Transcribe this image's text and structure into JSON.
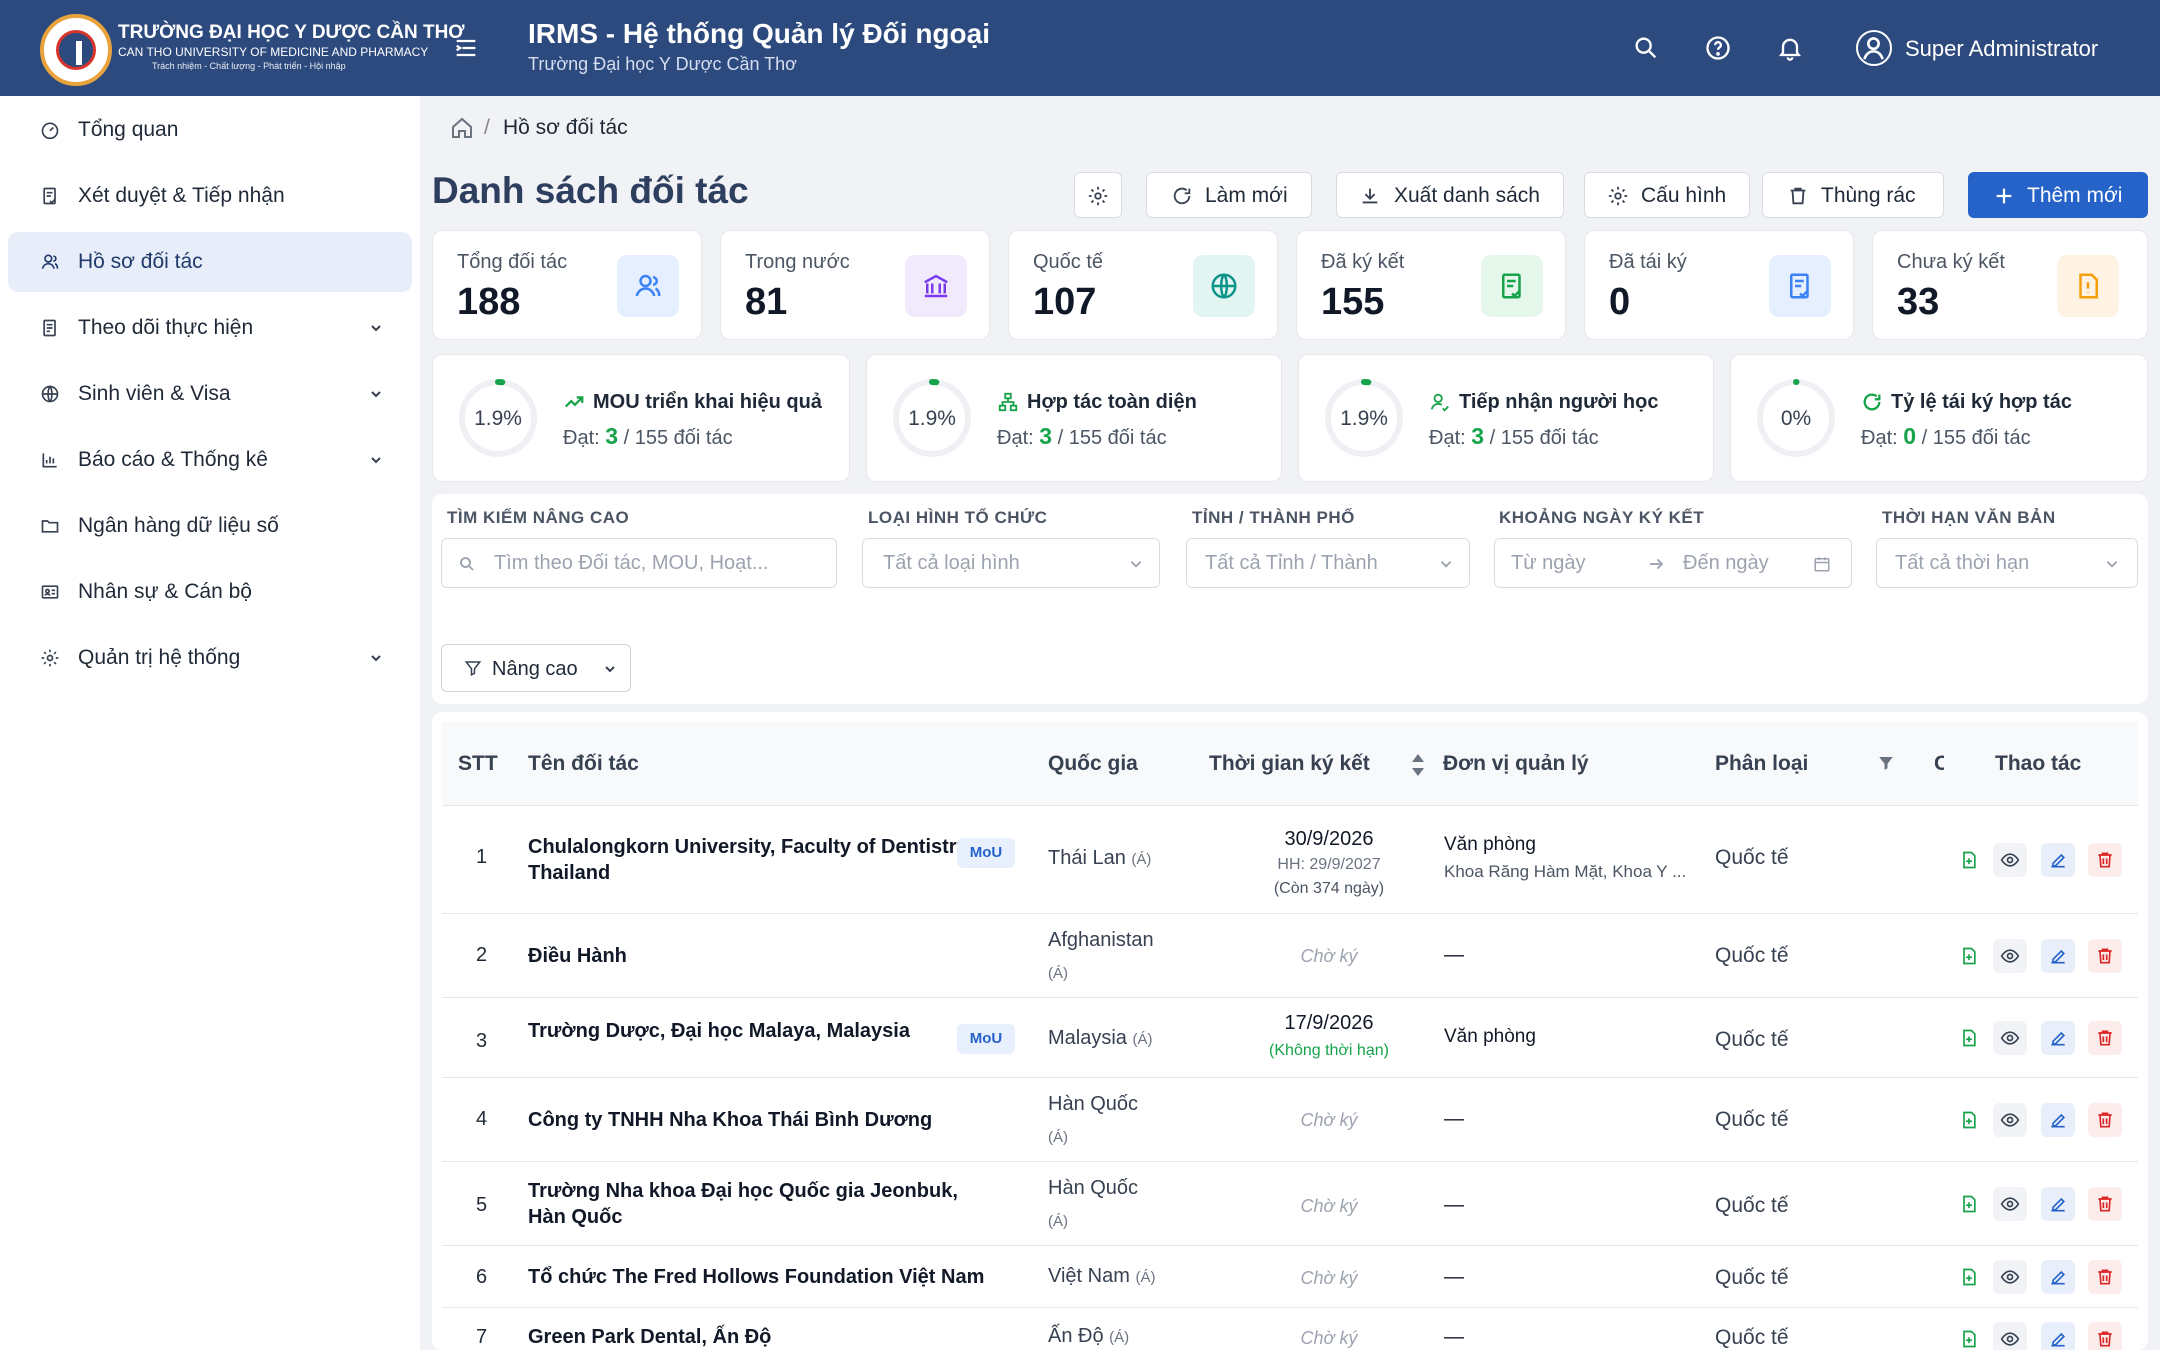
{
  "header": {
    "brand_vi": "TRƯỜNG ĐẠI HỌC Y DƯỢC CẦN THƠ",
    "brand_en": "CAN THO UNIVERSITY OF MEDICINE AND PHARMACY",
    "brand_motto": "Trách nhiệm - Chất lượng - Phát triển - Hội nhập",
    "app_title": "IRMS - Hệ thống Quản lý Đối ngoại",
    "app_subtitle": "Trường Đại học Y Dược Cần Thơ",
    "user": "Super Administrator",
    "icons": [
      "menu-icon",
      "search-icon",
      "help-icon",
      "bell-icon",
      "user-avatar-icon"
    ]
  },
  "sidebar": {
    "items": [
      {
        "label": "Tổng quan",
        "icon": "dashboard-icon",
        "expandable": false,
        "active": false
      },
      {
        "label": "Xét duyệt & Tiếp nhận",
        "icon": "review-icon",
        "expandable": false,
        "active": false
      },
      {
        "label": "Hồ sơ đối tác",
        "icon": "partners-icon",
        "expandable": false,
        "active": true
      },
      {
        "label": "Theo dõi thực hiện",
        "icon": "tracking-icon",
        "expandable": true,
        "active": false
      },
      {
        "label": "Sinh viên & Visa",
        "icon": "globe-icon",
        "expandable": true,
        "active": false
      },
      {
        "label": "Báo cáo & Thống kê",
        "icon": "chart-icon",
        "expandable": true,
        "active": false
      },
      {
        "label": "Ngân hàng dữ liệu số",
        "icon": "folder-icon",
        "expandable": false,
        "active": false
      },
      {
        "label": "Nhân sự & Cán bộ",
        "icon": "id-card-icon",
        "expandable": false,
        "active": false
      },
      {
        "label": "Quản trị hệ thống",
        "icon": "gear-icon",
        "expandable": true,
        "active": false
      }
    ]
  },
  "breadcrumb": {
    "separator": "/",
    "current": "Hồ sơ đối tác"
  },
  "page": {
    "title": "Danh sách đối tác"
  },
  "toolbar": {
    "refresh": "Làm mới",
    "export": "Xuất danh sách",
    "config": "Cấu hình",
    "trash": "Thùng rác",
    "add": "Thêm mới"
  },
  "stats": [
    {
      "label": "Tổng đối tác",
      "value": "188",
      "color": "#3b82f6"
    },
    {
      "label": "Trong nước",
      "value": "81",
      "color": "#7c3aed"
    },
    {
      "label": "Quốc tế",
      "value": "107",
      "color": "#0d9488"
    },
    {
      "label": "Đã ký kết",
      "value": "155",
      "color": "#16a34a"
    },
    {
      "label": "Đã tái ký",
      "value": "0",
      "color": "#3b82f6"
    },
    {
      "label": "Chưa ký kết",
      "value": "33",
      "color": "#f59e0b"
    }
  ],
  "kpis": [
    {
      "percent": "1.9%",
      "progress": 0.019,
      "title": "MOU triển khai hiệu quả",
      "prefix": "Đạt:",
      "value": "3",
      "suffix": "/ 155 đối tác"
    },
    {
      "percent": "1.9%",
      "progress": 0.019,
      "title": "Hợp tác toàn diện",
      "prefix": "Đạt:",
      "value": "3",
      "suffix": "/ 155 đối tác"
    },
    {
      "percent": "1.9%",
      "progress": 0.019,
      "title": "Tiếp nhận người học",
      "prefix": "Đạt:",
      "value": "3",
      "suffix": "/ 155 đối tác"
    },
    {
      "percent": "0%",
      "progress": 0,
      "title": "Tỷ lệ tái ký hợp tác",
      "prefix": "Đạt:",
      "value": "0",
      "suffix": "/ 155 đối tác"
    }
  ],
  "filters": {
    "search_label": "TÌM KIẾM NÂNG CAO",
    "search_placeholder": "Tìm theo Đối tác, MOU, Hoạt...",
    "org_label": "LOẠI HÌNH TỔ CHỨC",
    "org_placeholder": "Tất cả loại hình",
    "city_label": "TỈNH / THÀNH PHỐ",
    "city_placeholder": "Tất cả Tỉnh / Thành",
    "date_label": "KHOẢNG NGÀY KÝ KẾT",
    "date_from": "Từ ngày",
    "date_to": "Đến ngày",
    "term_label": "THỜI HẠN VĂN BẢN",
    "term_placeholder": "Tất cả thời hạn",
    "advanced": "Nâng cao"
  },
  "table": {
    "columns": [
      "STT",
      "Tên đối tác",
      "Quốc gia",
      "Thời gian ký kết",
      "Đơn vị quản lý",
      "Phân loại",
      "C",
      "Thao tác"
    ],
    "rows": [
      {
        "stt": "1",
        "name": "Chulalongkorn University, Faculty of Dentistry, Thailand",
        "badge": "MoU",
        "country": "Thái Lan",
        "region": "(Á)",
        "sign_date": "30/9/2026",
        "expiry": "HH: 29/9/2027",
        "remaining": "(Còn 374 ngày)",
        "unit": "Văn phòng",
        "unit_detail": "Khoa Răng Hàm Mặt, Khoa Y ...",
        "type": "Quốc tế"
      },
      {
        "stt": "2",
        "name": "Điều Hành",
        "badge": "",
        "country": "Afghanistan",
        "region": "(Á)",
        "status": "Chờ ký",
        "unit": "—",
        "type": "Quốc tế"
      },
      {
        "stt": "3",
        "name": "Trường Dược, Đại học Malaya, Malaysia",
        "badge": "MoU",
        "country": "Malaysia",
        "region": "(Á)",
        "sign_date": "17/9/2026",
        "term": "(Không thời hạn)",
        "unit": "Văn phòng",
        "type": "Quốc tế"
      },
      {
        "stt": "4",
        "name": "Công ty TNHH Nha Khoa Thái Bình Dương",
        "badge": "",
        "country": "Hàn Quốc",
        "region": "(Á)",
        "status": "Chờ ký",
        "unit": "—",
        "type": "Quốc tế"
      },
      {
        "stt": "5",
        "name": "Trường Nha khoa Đại học Quốc gia Jeonbuk, Hàn Quốc",
        "badge": "",
        "country": "Hàn Quốc",
        "region": "(Á)",
        "status": "Chờ ký",
        "unit": "—",
        "type": "Quốc tế"
      },
      {
        "stt": "6",
        "name": "Tổ chức The Fred Hollows Foundation Việt Nam",
        "badge": "",
        "country": "Việt Nam",
        "region": "(Á)",
        "status": "Chờ ký",
        "unit": "—",
        "type": "Quốc tế"
      },
      {
        "stt": "7",
        "name": "Green Park Dental, Ấn Độ",
        "badge": "",
        "country": "Ấn Độ",
        "region": "(Á)",
        "status": "Chờ ký",
        "unit": "—",
        "type": "Quốc tế"
      }
    ]
  }
}
